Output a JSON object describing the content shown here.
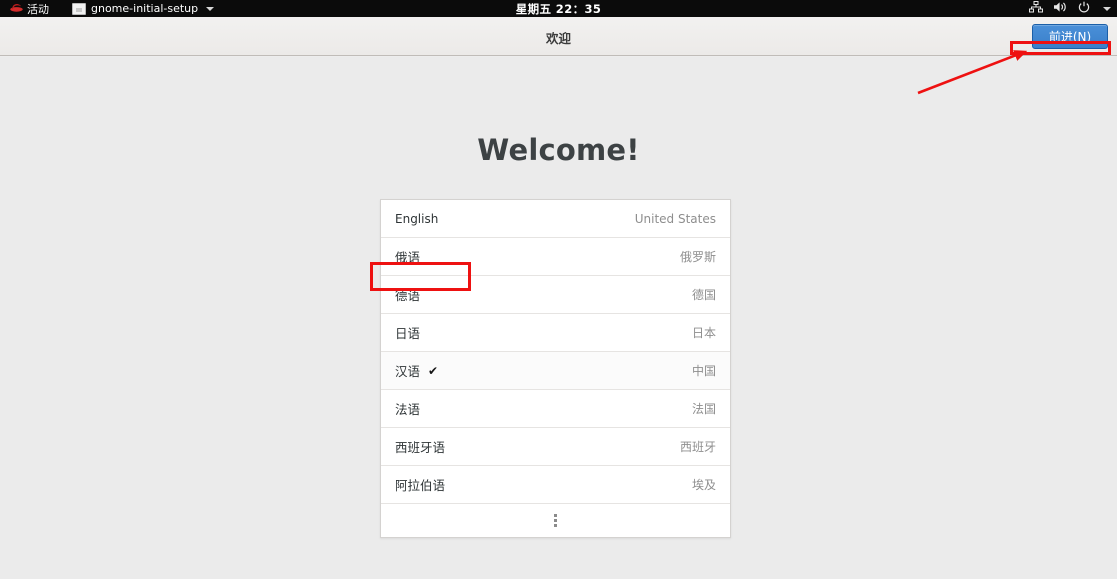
{
  "topbar": {
    "activities_label": "活动",
    "activities_icon": "fedora-logo-icon",
    "window_title": "gnome-initial-setup",
    "window_icon": "window-icon",
    "window_menu_icon": "caret-down-icon",
    "clock": "星期五 22：35",
    "indicators": [
      {
        "name": "network-icon"
      },
      {
        "name": "volume-icon"
      },
      {
        "name": "power-icon"
      },
      {
        "name": "system-menu-caret-icon"
      }
    ]
  },
  "header": {
    "title": "欢迎",
    "next_label": "前进(N)"
  },
  "main": {
    "welcome_title": "Welcome!",
    "language_rows": [
      {
        "name": "English",
        "country": "United States",
        "latin": true,
        "selected": false
      },
      {
        "name": "俄语",
        "country": "俄罗斯",
        "latin": false,
        "selected": false
      },
      {
        "name": "德语",
        "country": "德国",
        "latin": false,
        "selected": false
      },
      {
        "name": "日语",
        "country": "日本",
        "latin": false,
        "selected": false
      },
      {
        "name": "汉语",
        "country": "中国",
        "latin": false,
        "selected": true,
        "check": "✔"
      },
      {
        "name": "法语",
        "country": "法国",
        "latin": false,
        "selected": false
      },
      {
        "name": "西班牙语",
        "country": "西班牙",
        "latin": false,
        "selected": false
      },
      {
        "name": "阿拉伯语",
        "country": "埃及",
        "latin": false,
        "selected": false
      }
    ],
    "more_row_icon": "more-vertical-icon"
  },
  "annotations": {
    "highlight_color": "#ee1111",
    "english_row_box": "annotation-rect-english",
    "next_button_box": "annotation-rect-next-button",
    "arrow": "annotation-arrow-to-next-button"
  }
}
